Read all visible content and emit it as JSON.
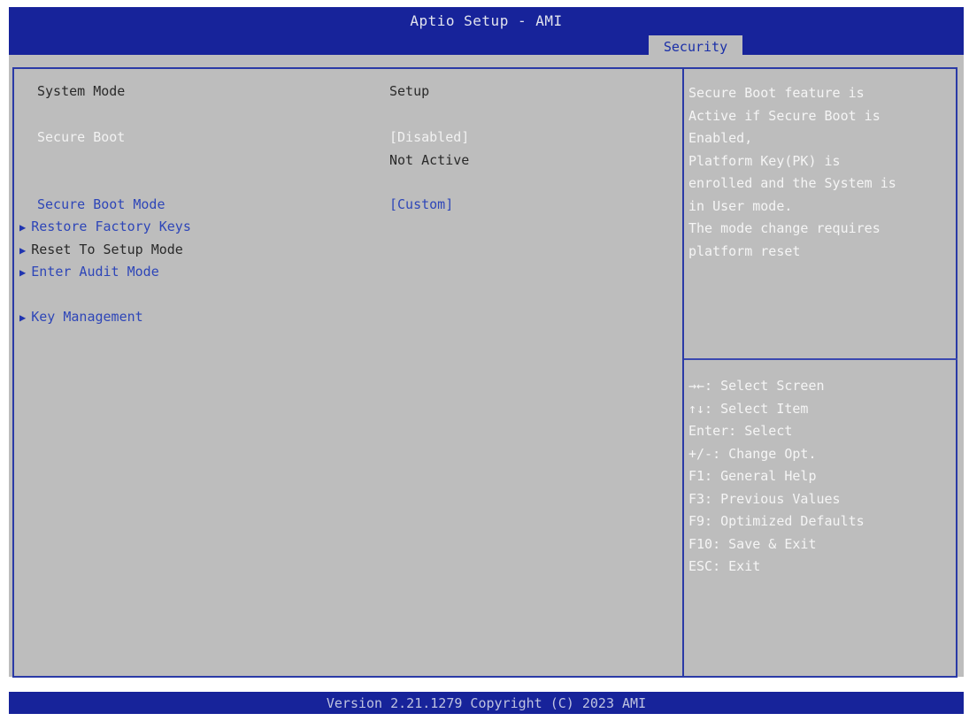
{
  "header": {
    "title": "Aptio Setup - AMI",
    "active_tab": "Security"
  },
  "settings": {
    "system_mode": {
      "label": "System Mode",
      "value": "Setup"
    },
    "secure_boot": {
      "label": "Secure Boot",
      "value": "[Disabled]",
      "status": "Not Active"
    },
    "secure_boot_mode": {
      "label": "Secure Boot Mode",
      "value": "[Custom]"
    },
    "submenus": [
      "Restore Factory Keys",
      "Reset To Setup Mode",
      "Enter Audit Mode",
      "Key Management"
    ]
  },
  "help": {
    "lines": [
      "Secure Boot feature is",
      "Active if Secure Boot is",
      "Enabled,",
      "Platform Key(PK) is",
      "enrolled and the System is",
      "in User mode.",
      "The mode change requires",
      "platform reset"
    ]
  },
  "keys": [
    "→←: Select Screen",
    "↑↓: Select Item",
    "Enter: Select",
    "+/-: Change Opt.",
    "F1: General Help",
    "F3: Previous Values",
    "F9: Optimized Defaults",
    "F10: Save & Exit",
    "ESC: Exit"
  ],
  "footer": {
    "text": "Version 2.21.1279 Copyright (C) 2023 AMI"
  },
  "colors": {
    "header_bg": "#17239a",
    "panel_bg": "#bdbdbd",
    "border": "#2a3aa6",
    "option_blue": "#2e46b8",
    "highlight_white": "#f2f2f2"
  }
}
